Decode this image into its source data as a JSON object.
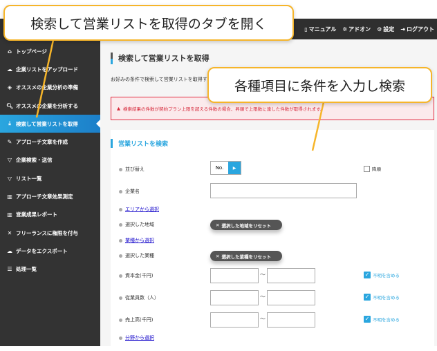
{
  "topnav": {
    "manual": "マニュアル",
    "addon": "アドオン",
    "settings": "設定",
    "logout": "ログアウト"
  },
  "sidebar": {
    "items": [
      {
        "label": "トップページ",
        "icon": "home-icon"
      },
      {
        "label": "企業リストをアップロード",
        "icon": "cloud-upload-icon"
      },
      {
        "label": "オススメの企業分析の準備",
        "icon": "layers-icon"
      },
      {
        "label": "オススメの企業を分析する",
        "icon": "search-icon"
      },
      {
        "label": "検索して営業リストを取得",
        "icon": "download-icon"
      },
      {
        "label": "アプローチ文章を作成",
        "icon": "pencil-icon"
      },
      {
        "label": "企業検索・送信",
        "icon": "filter-icon"
      },
      {
        "label": "リスト一覧",
        "icon": "filter-icon"
      },
      {
        "label": "アプローチ文章効果測定",
        "icon": "bar-chart-icon"
      },
      {
        "label": "営業成果レポート",
        "icon": "bar-chart-icon"
      },
      {
        "label": "フリーランスに権限を付与",
        "icon": "tools-icon"
      },
      {
        "label": "データをエクスポート",
        "icon": "cloud-icon"
      },
      {
        "label": "処理一覧",
        "icon": "list-icon"
      }
    ]
  },
  "main": {
    "title": "検索して営業リストを取得",
    "description": "お好みの条件で検索して営業リストを取得す",
    "alert": "検索結果の件数が契約プラン上限を超える件数の場合、昇順で上限数に達した件数が取得されます。",
    "section_title": "営業リストを検索",
    "sort_label": "並び替え",
    "sort_value": "No.",
    "desc_order": "降順",
    "company_label": "企業名",
    "area_link": "エリアから選択",
    "selected_area": "選択した地域",
    "reset_area": "選択した地域をリセット",
    "industry_link": "業種から選択",
    "selected_industry": "選択した業種",
    "reset_industry": "選択した業種をリセット",
    "capital": "資本金(千円)",
    "employees": "従業員数（人）",
    "sales": "売上高(千円)",
    "tilde": "〜",
    "include_unknown": "不明を含める",
    "field_link": "分野から選択"
  },
  "callouts": {
    "first": "検索して営業リストを取得のタブを開く",
    "second": "各種項目に条件を入力し検索"
  },
  "colors": {
    "accent": "#2aa6df",
    "callout": "#f6b52a",
    "alert": "#e0283c"
  }
}
